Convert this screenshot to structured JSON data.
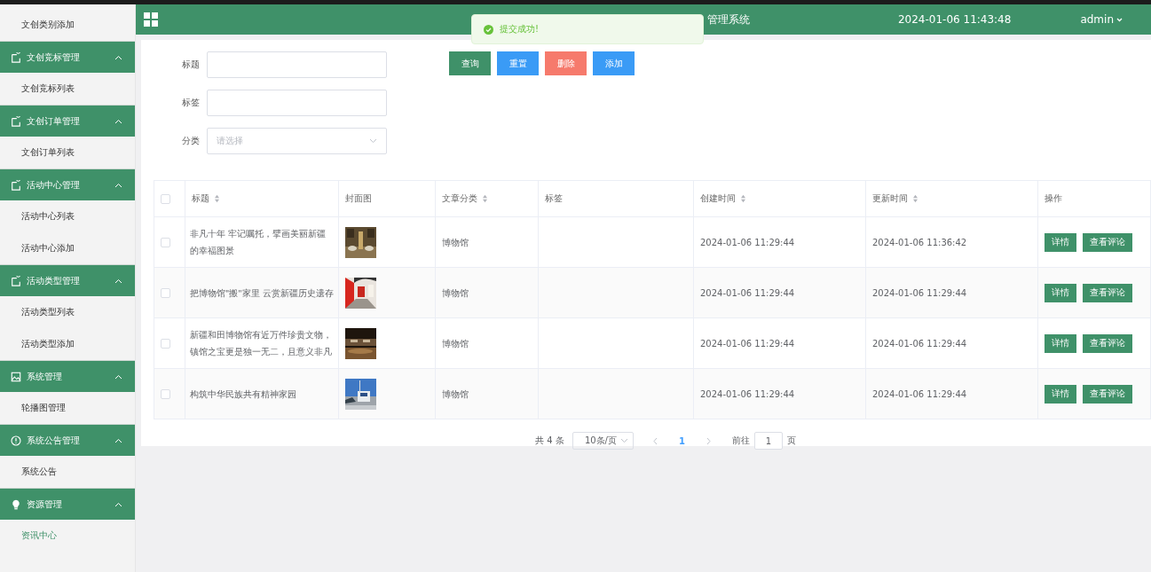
{
  "sidebar": {
    "items": [
      {
        "kind": "item",
        "label": "文创类别添加",
        "selected": false
      },
      {
        "kind": "group",
        "label": "文创竞标管理",
        "expanded": true
      },
      {
        "kind": "item",
        "label": "文创竞标列表",
        "selected": false
      },
      {
        "kind": "group",
        "label": "文创订单管理",
        "expanded": true
      },
      {
        "kind": "item",
        "label": "文创订单列表",
        "selected": false
      },
      {
        "kind": "group",
        "label": "活动中心管理",
        "expanded": true
      },
      {
        "kind": "item",
        "label": "活动中心列表",
        "selected": false
      },
      {
        "kind": "item",
        "label": "活动中心添加",
        "selected": false
      },
      {
        "kind": "group",
        "label": "活动类型管理",
        "expanded": true
      },
      {
        "kind": "item",
        "label": "活动类型列表",
        "selected": false
      },
      {
        "kind": "item",
        "label": "活动类型添加",
        "selected": false
      },
      {
        "kind": "group",
        "label": "系统管理",
        "expanded": true
      },
      {
        "kind": "item",
        "label": "轮播图管理",
        "selected": false
      },
      {
        "kind": "group",
        "label": "系统公告管理",
        "expanded": true
      },
      {
        "kind": "item",
        "label": "系统公告",
        "selected": false
      },
      {
        "kind": "group",
        "label": "资源管理",
        "expanded": true
      },
      {
        "kind": "item",
        "label": "资讯中心",
        "selected": true
      }
    ]
  },
  "header": {
    "title": "管理系统",
    "datetime": "2024-01-06 11:43:48",
    "user": "admin"
  },
  "toast": {
    "message": "提交成功!"
  },
  "filters": [
    {
      "kind": "input",
      "label": "标题"
    },
    {
      "kind": "input",
      "label": "标签"
    },
    {
      "kind": "select",
      "label": "分类",
      "placeholder": "请选择"
    }
  ],
  "actions": [
    {
      "label": "查询",
      "kind": "primary"
    },
    {
      "label": "重置",
      "kind": "info"
    },
    {
      "label": "删除",
      "kind": "danger"
    },
    {
      "label": "添加",
      "kind": "info"
    }
  ],
  "table": {
    "all_checked": false,
    "columns": [
      {
        "label": "标题",
        "sortable": true
      },
      {
        "label": "封面图",
        "sortable": false
      },
      {
        "label": "文章分类",
        "sortable": true
      },
      {
        "label": "标签",
        "sortable": false
      },
      {
        "label": "创建时间",
        "sortable": true
      },
      {
        "label": "更新时间",
        "sortable": true
      },
      {
        "label": "操作",
        "sortable": false
      }
    ],
    "rows": [
      {
        "checked": false,
        "title": "非凡十年 牢记嘱托，擘画美丽新疆的幸福图景",
        "cover": {
          "kind": "picture"
        },
        "category": "博物馆",
        "created": "2024-01-06 11:29:44",
        "updated": "2024-01-06 11:36:42",
        "buttons": [
          "详情",
          "查看评论"
        ]
      },
      {
        "checked": false,
        "title": "把博物馆\"搬\"家里 云赏新疆历史遗存",
        "cover": {
          "kind": "picture"
        },
        "category": "博物馆",
        "created": "2024-01-06 11:29:44",
        "updated": "2024-01-06 11:29:44",
        "buttons": [
          "详情",
          "查看评论"
        ]
      },
      {
        "checked": false,
        "title": "新疆和田博物馆有近万件珍贵文物，镇馆之宝更是独一无二，且意义非凡",
        "cover": {
          "kind": "picture"
        },
        "category": "博物馆",
        "created": "2024-01-06 11:29:44",
        "updated": "2024-01-06 11:29:44",
        "buttons": [
          "详情",
          "查看评论"
        ]
      },
      {
        "checked": false,
        "title": "构筑中华民族共有精神家园",
        "cover": {
          "kind": "picture"
        },
        "category": "博物馆",
        "created": "2024-01-06 11:29:44",
        "updated": "2024-01-06 11:29:44",
        "buttons": [
          "详情",
          "查看评论"
        ]
      }
    ]
  },
  "pagination": {
    "total": "共 4 条",
    "page_size": "10条/页",
    "pages": [
      {
        "label": "1",
        "selected": true
      }
    ],
    "goto_label": "前往",
    "goto_value": "1",
    "goto_suffix": "页"
  }
}
